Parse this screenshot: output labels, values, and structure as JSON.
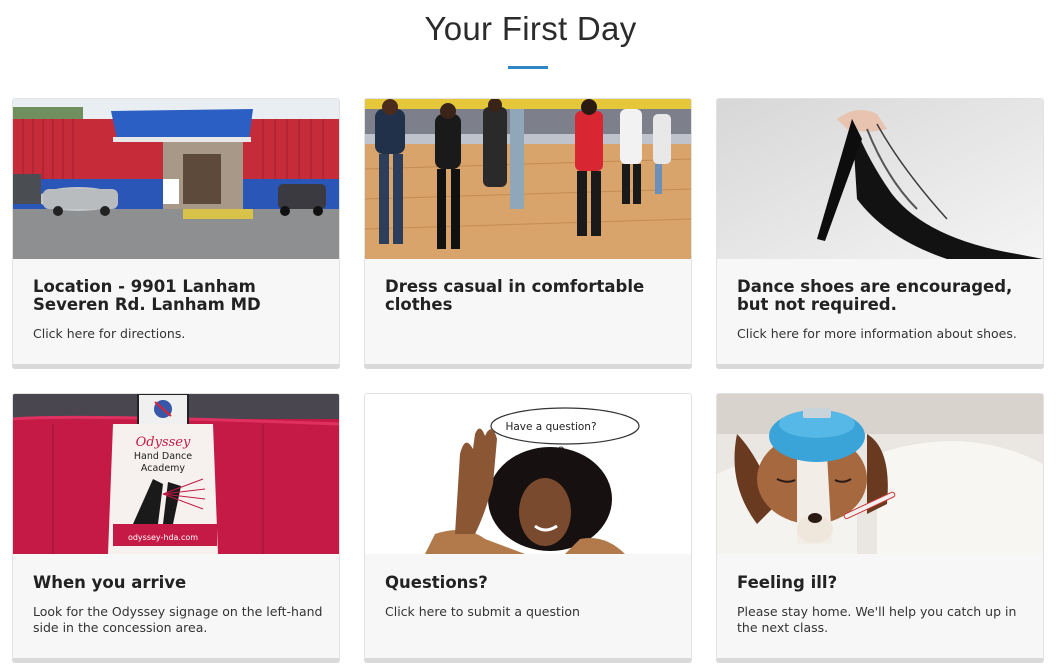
{
  "page": {
    "title": "Your First Day",
    "accent_color": "#2f86c5"
  },
  "cards": [
    {
      "title": "Location - 9901 Lanham Severen Rd. Lanham MD",
      "text": "Click here for directions.",
      "image": "building-exterior-photo"
    },
    {
      "title": "Dress casual in comfortable clothes",
      "text": "",
      "image": "dancers-on-floor-photo"
    },
    {
      "title": "Dance shoes are encouraged, but not required.",
      "text": "Click here for more information about shoes.",
      "image": "high-heel-shoe-photo"
    },
    {
      "title": "When you arrive",
      "text": "Look for the Odyssey signage on the left-hand side in the concession area.",
      "image": "odyssey-table-signage-photo",
      "sign_lines": [
        "Odyssey",
        "Hand Dance",
        "Academy",
        "odyssey-hda.com"
      ]
    },
    {
      "title": "Questions?",
      "text": "Click here to submit a question",
      "image": "woman-raising-hand-photo",
      "bubble_text": "Have a question?"
    },
    {
      "title": "Feeling ill?",
      "text": "Please stay home. We'll help you catch up in the next class.",
      "image": "sick-dog-photo"
    }
  ]
}
